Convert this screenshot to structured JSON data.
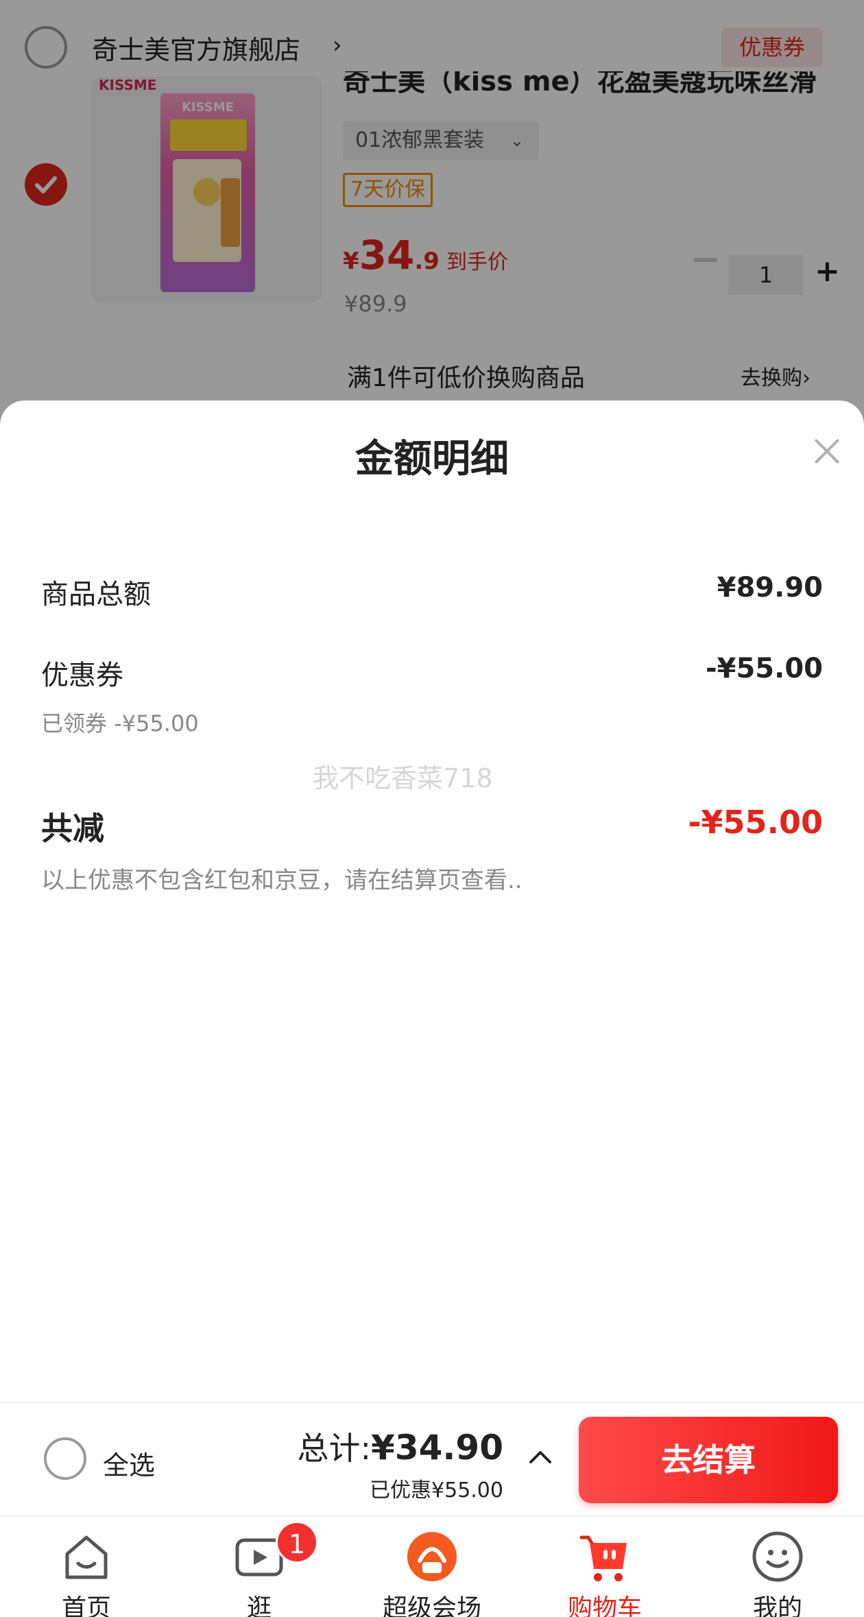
{
  "store": {
    "name": "奇士美官方旗舰店",
    "chevron": "›",
    "coupon_button": "优惠券"
  },
  "product": {
    "image_brand": "KISSME",
    "title": "奇士美（kiss me）花盈美蔻玩味丝滑",
    "variant": "01浓郁黑套装",
    "price_guarantee_tag": "7天价保",
    "price_currency": "¥",
    "price_int": "34",
    "price_dec": ".9",
    "price_label": "到手价",
    "original_price": "¥89.9",
    "quantity": "1",
    "promo_text": "满1件可低价换购商品",
    "promo_link": "去换购›"
  },
  "sheet": {
    "title": "金额明细",
    "rows": {
      "goods_total_label": "商品总额",
      "goods_total_value": "¥89.90",
      "coupon_label": "优惠券",
      "coupon_value": "-¥55.00",
      "coupon_detail": "已领券 -¥55.00",
      "watermark": "我不吃香菜718",
      "discount_total_label": "共减",
      "discount_total_value": "-¥55.00",
      "note": "以上优惠不包含红包和京豆，请在结算页查看.."
    }
  },
  "checkout": {
    "select_all": "全选",
    "total_label": "总计:",
    "total_amount": "¥34.90",
    "saved": "已优惠¥55.00",
    "button": "去结算"
  },
  "tabbar": {
    "tabs": [
      {
        "label": "首页",
        "icon": "home-icon"
      },
      {
        "label": "逛",
        "icon": "video-icon",
        "badge": "1"
      },
      {
        "label": "超级会场",
        "icon": "super-venue-icon"
      },
      {
        "label": "购物车",
        "icon": "cart-icon",
        "active": true
      },
      {
        "label": "我的",
        "icon": "profile-icon"
      }
    ]
  },
  "colors": {
    "accent_red": "#e1251b",
    "price_guard_orange": "#f08a00"
  }
}
